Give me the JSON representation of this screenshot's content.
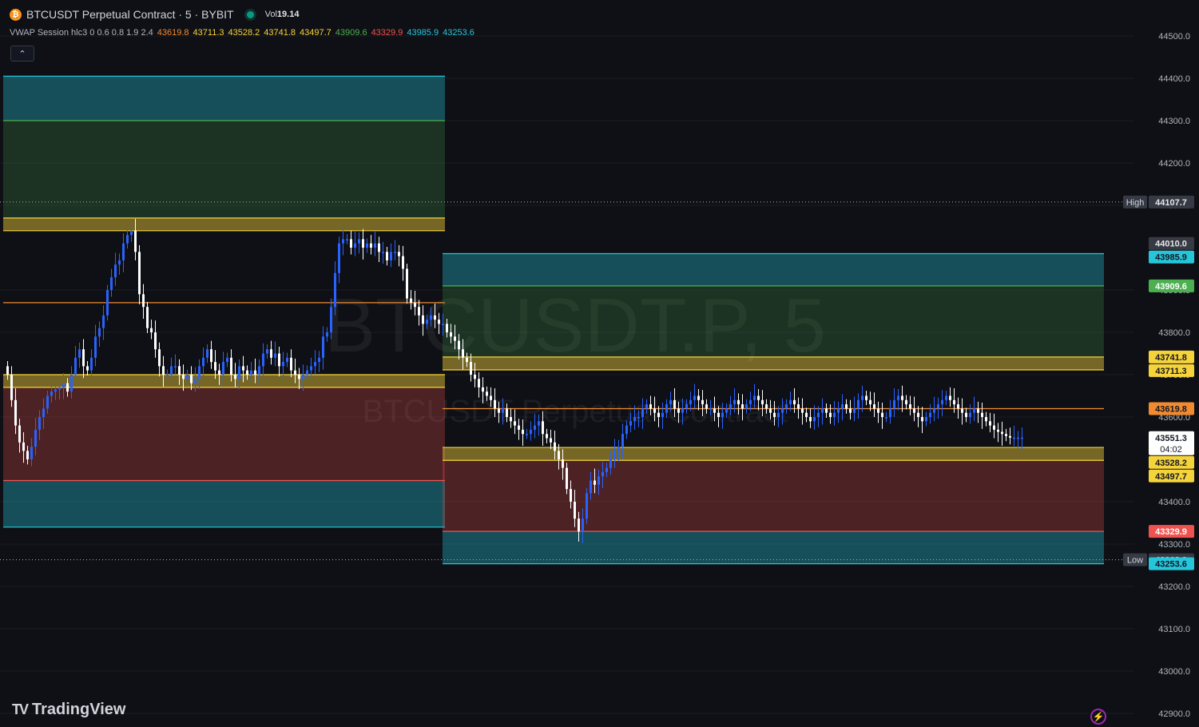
{
  "header": {
    "coin_glyph": "₿",
    "title": "BTCUSDT Perpetual Contract · 5 · BYBIT",
    "vol_label": "Vol",
    "vol_value": "19.14"
  },
  "indicator": {
    "name": "VWAP Session hlc3 0 0.6 0.8 1.9 2.4",
    "values": [
      {
        "text": "43619.8",
        "color": "#f28b30"
      },
      {
        "text": "43711.3",
        "color": "#f5d33b"
      },
      {
        "text": "43528.2",
        "color": "#f5d33b"
      },
      {
        "text": "43741.8",
        "color": "#f5d33b"
      },
      {
        "text": "43497.7",
        "color": "#f5d33b"
      },
      {
        "text": "43909.6",
        "color": "#4caf50"
      },
      {
        "text": "43329.9",
        "color": "#ef5350"
      },
      {
        "text": "43985.9",
        "color": "#26c6da"
      },
      {
        "text": "43253.6",
        "color": "#26c6da"
      }
    ]
  },
  "collapse_glyph": "⌃",
  "watermark": {
    "line1": "BTCUSDT.P, 5",
    "line2": "BTCUSDT Perpetual Contract"
  },
  "brand": {
    "logo": "TV",
    "name": "TradingView"
  },
  "bolt_glyph": "⚡",
  "chart_data": {
    "type": "candlestick",
    "symbol": "BTCUSDT Perpetual Contract",
    "timeframe": "5",
    "exchange": "BYBIT",
    "y_axis": {
      "ticks": [
        44500,
        44400,
        44300,
        44200,
        44100,
        43900,
        43800,
        43700,
        43600,
        43400,
        43300,
        43200,
        43100,
        43000,
        42900
      ],
      "format": "0.0"
    },
    "high_marker": {
      "label": "High",
      "value": "44107.7"
    },
    "low_marker": {
      "label": "Low",
      "value": "43262.9"
    },
    "price_labels": [
      {
        "value": "44010.0",
        "color": "#e6e6e6",
        "bg": "#363a45"
      },
      {
        "value": "43985.9",
        "color": "#131722",
        "bg": "#26c6da"
      },
      {
        "value": "43909.6",
        "color": "#ffffff",
        "bg": "#4caf50"
      },
      {
        "value": "43741.8",
        "color": "#131722",
        "bg": "#f5d33b"
      },
      {
        "value": "43711.3",
        "color": "#131722",
        "bg": "#f5d33b"
      },
      {
        "value": "43619.8",
        "color": "#131722",
        "bg": "#f28b30"
      },
      {
        "value": "43551.3",
        "sub": "04:02",
        "color": "#131722",
        "bg": "#ffffff"
      },
      {
        "value": "43528.2",
        "color": "#131722",
        "bg": "#f5d33b"
      },
      {
        "value": "43497.7",
        "color": "#131722",
        "bg": "#f5d33b"
      },
      {
        "value": "43329.9",
        "color": "#ffffff",
        "bg": "#ef5350"
      },
      {
        "value": "43253.6",
        "color": "#131722",
        "bg": "#26c6da"
      }
    ],
    "bands": {
      "vwap": "#f28b30",
      "inner": "#f5d33b",
      "mid_upper": "#4caf50",
      "mid_lower": "#ef5350",
      "outer": "#26c6da"
    },
    "sessions": [
      {
        "start_bar": 0,
        "end_bar": 109,
        "vwap": 43870,
        "u1": 44040,
        "u2": 44070,
        "u3": 44300,
        "u4": 44405,
        "l1": 43700,
        "l2": 43670,
        "l3": 43450,
        "l4": 43340
      },
      {
        "start_bar": 110,
        "end_bar": 274,
        "vwap": 43619.8,
        "u1": 43711.3,
        "u2": 43741.8,
        "u3": 43909.6,
        "u4": 43985.9,
        "l1": 43528.2,
        "l2": 43497.7,
        "l3": 43329.9,
        "l4": 43253.6
      }
    ],
    "candle_colors": {
      "up": "#2962ff",
      "down": "#ffffff"
    },
    "series": [
      {
        "name": "close",
        "values": [
          43700,
          43640,
          43580,
          43540,
          43520,
          43500,
          43530,
          43570,
          43600,
          43620,
          43650,
          43660,
          43665,
          43670,
          43680,
          43660,
          43700,
          43740,
          43760,
          43720,
          43710,
          43740,
          43790,
          43810,
          43840,
          43900,
          43930,
          43960,
          43970,
          44010,
          44030,
          44040,
          43990,
          43890,
          43860,
          43810,
          43800,
          43760,
          43720,
          43700,
          43700,
          43720,
          43720,
          43700,
          43690,
          43700,
          43680,
          43690,
          43720,
          43740,
          43760,
          43730,
          43710,
          43700,
          43730,
          43740,
          43700,
          43690,
          43720,
          43710,
          43700,
          43710,
          43700,
          43720,
          43750,
          43760,
          43740,
          43750,
          43720,
          43730,
          43740,
          43710,
          43700,
          43690,
          43700,
          43710,
          43720,
          43730,
          43740,
          43790,
          43800,
          43860,
          43940,
          44010,
          44020,
          44020,
          44000,
          44010,
          44020,
          44000,
          44010,
          44000,
          44010,
          43990,
          43990,
          43970,
          43990,
          43990,
          43980,
          43950,
          43880,
          43870,
          43860,
          43840,
          43820,
          43830,
          43840,
          43830,
          43820,
          43820,
          43800,
          43790,
          43780,
          43760,
          43740,
          43730,
          43700,
          43690,
          43670,
          43660,
          43650,
          43640,
          43620,
          43610,
          43620,
          43600,
          43590,
          43580,
          43570,
          43560,
          43560,
          43570,
          43580,
          43590,
          43560,
          43550,
          43540,
          43520,
          43500,
          43480,
          43430,
          43400,
          43360,
          43330,
          43360,
          43420,
          43450,
          43440,
          43460,
          43470,
          43480,
          43500,
          43520,
          43530,
          43560,
          43580,
          43590,
          43600,
          43600,
          43620,
          43630,
          43620,
          43610,
          43600,
          43610,
          43630,
          43640,
          43620,
          43610,
          43620,
          43630,
          43640,
          43650,
          43640,
          43630,
          43620,
          43620,
          43610,
          43600,
          43610,
          43620,
          43630,
          43640,
          43630,
          43620,
          43630,
          43640,
          43650,
          43640,
          43630,
          43620,
          43610,
          43600,
          43610,
          43620,
          43630,
          43640,
          43630,
          43620,
          43610,
          43600,
          43590,
          43600,
          43610,
          43620,
          43610,
          43600,
          43610,
          43620,
          43630,
          43620,
          43610,
          43620,
          43640,
          43650,
          43640,
          43630,
          43620,
          43610,
          43600,
          43600,
          43620,
          43640,
          43650,
          43640,
          43630,
          43620,
          43610,
          43600,
          43590,
          43600,
          43610,
          43620,
          43630,
          43640,
          43650,
          43640,
          43630,
          43620,
          43610,
          43600,
          43610,
          43620,
          43610,
          43600,
          43590,
          43580,
          43570,
          43565,
          43560,
          43555,
          43551.3,
          43551.3,
          43551.3,
          43551.3
        ]
      }
    ]
  }
}
